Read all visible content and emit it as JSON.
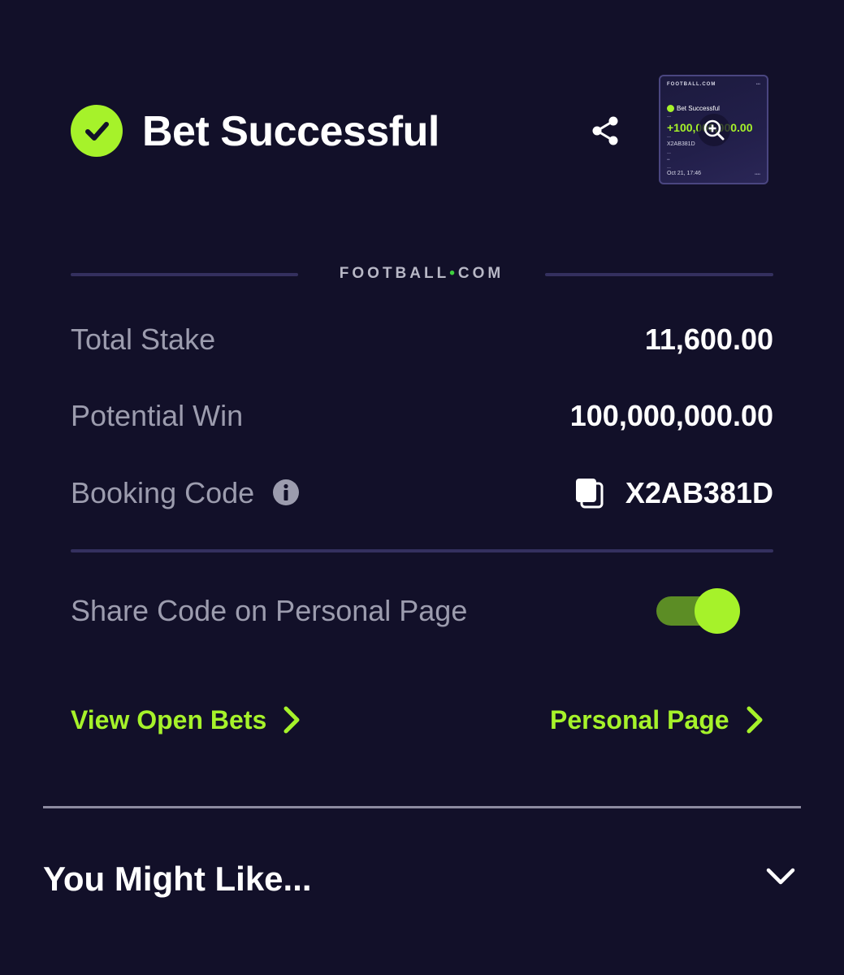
{
  "header": {
    "title": "Bet Successful",
    "icons": {
      "success": "check-circle-icon",
      "share": "share-icon"
    }
  },
  "thumbnail": {
    "brand": "FOOTBALL.COM",
    "title": "Bet Successful",
    "potential_win": "+100,000,000.00",
    "booking_code": "X2AB381D",
    "date": "Oct 21, 17:46",
    "zoom_icon": "zoom-in-icon"
  },
  "brand_divider": {
    "text_left": "FOOTBALL",
    "dot": "•",
    "text_right": "COM"
  },
  "summary": {
    "total_stake_label": "Total Stake",
    "total_stake_value": "11,600.00",
    "potential_win_label": "Potential Win",
    "potential_win_value": "100,000,000.00",
    "booking_code_label": "Booking Code",
    "booking_code_value": "X2AB381D"
  },
  "share": {
    "label": "Share Code on Personal Page",
    "enabled": true
  },
  "links": {
    "view_open_bets": "View Open Bets",
    "personal_page": "Personal Page"
  },
  "recommendations": {
    "title": "You Might Like..."
  },
  "colors": {
    "background": "#121029",
    "accent": "#a6f22a",
    "divider": "#34305f",
    "label": "#9c9cae"
  }
}
